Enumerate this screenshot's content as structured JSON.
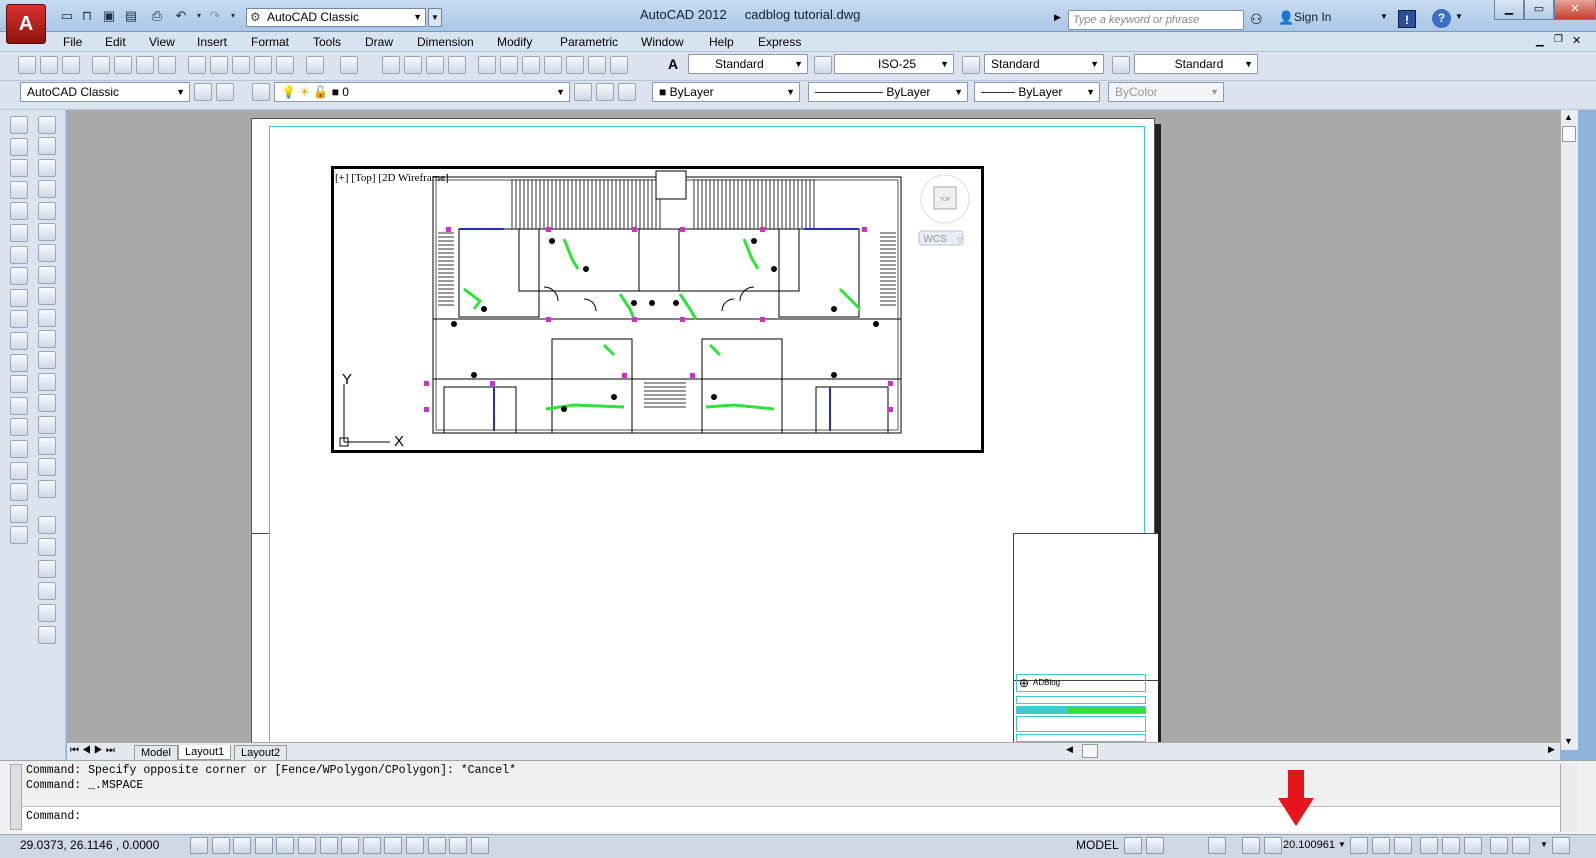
{
  "app": {
    "app_name": "AutoCAD 2012",
    "filename": "cadblog tutorial.dwg",
    "workspace": "AutoCAD Classic",
    "search_placeholder": "Type a keyword or phrase",
    "sign_in": "Sign In",
    "app_button_letter": "A"
  },
  "menu": [
    "File",
    "Edit",
    "View",
    "Insert",
    "Format",
    "Tools",
    "Draw",
    "Dimension",
    "Modify",
    "Parametric",
    "Window",
    "Help",
    "Express"
  ],
  "styles_toolbar": {
    "text_style": "Standard",
    "dim_style": "ISO-25",
    "table_style": "Standard",
    "mleader_style": "Standard"
  },
  "layers_toolbar": {
    "workspace": "AutoCAD Classic",
    "layer": "0",
    "color": "ByLayer",
    "linetype": "ByLayer",
    "lineweight": "ByLayer",
    "plotstyle": "ByColor"
  },
  "viewport": {
    "label": "[+] [Top] [2D Wireframe]",
    "ucs_y": "Y",
    "ucs_x": "X",
    "viewcube_face": "TOP",
    "wcs": "WCS"
  },
  "titleblock": {
    "logo_text": "ADBlog"
  },
  "tabs": [
    "Model",
    "Layout1",
    "Layout2"
  ],
  "command": {
    "line1": "Command: Specify opposite corner or [Fence/WPolygon/CPolygon]: *Cancel*",
    "line2": "Command: _.MSPACE",
    "prompt": "Command:"
  },
  "status": {
    "coordinates": "29.0373, 26.1146 , 0.0000",
    "space": "MODEL",
    "scale": "20.100961"
  },
  "colors": {
    "accent_red": "#e8141c",
    "margin_cyan": "#3fc9d0",
    "drawing_green": "#2ee23a"
  }
}
